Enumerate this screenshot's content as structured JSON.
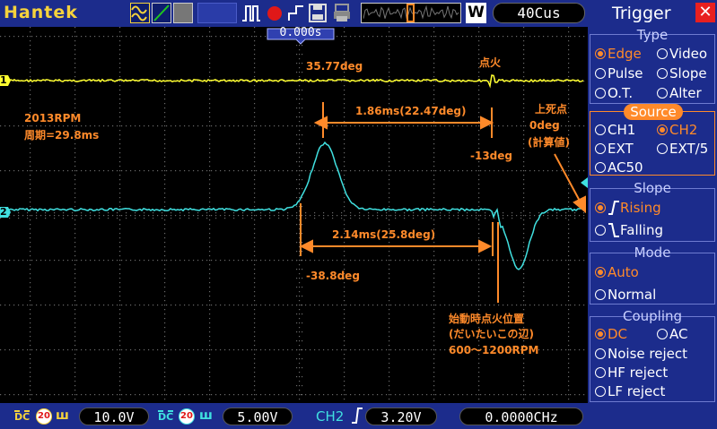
{
  "brand": "Hantek",
  "toolbar": {
    "icons": [
      "sine-wave-icon",
      "cursor-icon",
      "persistence-icon",
      "blank-button",
      "pulse-icon",
      "record-icon",
      "step-icon",
      "save-icon",
      "print-icon"
    ],
    "run_mode": "W",
    "timebase": "40Cus"
  },
  "screen": {
    "trigger_time": "0.000s",
    "ch1_marker": "1",
    "ch2_marker": "2"
  },
  "annotations": {
    "rpm": "2013RPM",
    "period": "周期=29.8ms",
    "deg_top": "35.77deg",
    "ignition": "点火",
    "tdc_1": "上死点",
    "tdc_2": "0deg",
    "tdc_3": "(計算値)",
    "span_top": "1.86ms(22.47deg)",
    "minus13": "-13deg",
    "span_bottom": "2.14ms(25.8deg)",
    "minus38": "-38.8deg",
    "start_1": "始動時点火位置",
    "start_2": "(だいたいこの辺)",
    "start_3": "600～1200RPM"
  },
  "status": {
    "ch1_coupling": "DC",
    "ch1_bw": "20",
    "ch1_volts": "10.0V",
    "ch2_coupling": "DC",
    "ch2_bw": "20",
    "ch2_volts": "5.00V",
    "trig_source": "CH2",
    "trig_level": "3.20V",
    "frequency": "0.0000CHz"
  },
  "panel": {
    "title": "Trigger",
    "type_title": "Type",
    "type_opts": [
      "Edge",
      "Video",
      "Pulse",
      "Slope",
      "O.T.",
      "Alter"
    ],
    "source_title": "Source",
    "source_opts": [
      "CH1",
      "CH2",
      "EXT",
      "EXT/5",
      "AC50"
    ],
    "slope_title": "Slope",
    "slope_opts": [
      "Rising",
      "Falling"
    ],
    "mode_title": "Mode",
    "mode_opts": [
      "Auto",
      "Normal"
    ],
    "coupling_title": "Coupling",
    "coupling_opts": [
      "DC",
      "AC",
      "Noise reject",
      "HF reject",
      "LF reject"
    ]
  },
  "colors": {
    "ch1": "#ffff30",
    "ch2": "#40e0e0",
    "annotation": "#ff8a2a",
    "ui_blue": "#1c2c8c"
  }
}
